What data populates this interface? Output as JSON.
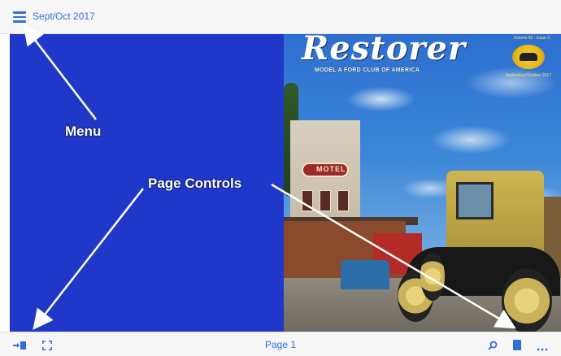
{
  "header": {
    "title": "Sept/Oct 2017"
  },
  "cover": {
    "masthead": "Restorer",
    "club_name": "MODEL A FORD CLUB OF AMERICA",
    "volume": "Volume 62 · Issue 3",
    "edition": "September/October 2017",
    "sign_text": "MOTEL"
  },
  "annotations": {
    "menu": "Menu",
    "page_controls": "Page Controls"
  },
  "footer": {
    "page_label": "Page 1"
  },
  "icons": {
    "menu": "hamburger-menu-icon",
    "sidebar_toggle": "sidebar-toggle-icon",
    "fullscreen": "fullscreen-icon",
    "search": "search-icon",
    "bookmark": "bookmark-icon",
    "more": "more-icon"
  },
  "colors": {
    "accent": "#2f6fd8",
    "left_page": "#1f38c9"
  }
}
